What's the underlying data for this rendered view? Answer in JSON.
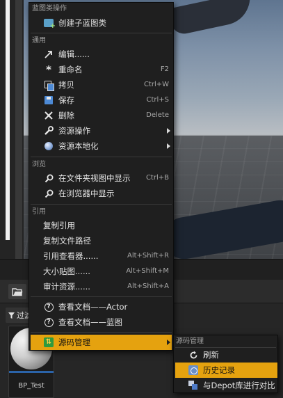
{
  "editor": {
    "toolbar_folder_icon": "folder-open-icon",
    "filter_label": "过滤",
    "asset_name": "BP_Test"
  },
  "menu": {
    "sections": {
      "blueprint": "蓝图类操作",
      "common": "通用",
      "browse": "浏览",
      "references": "引用"
    },
    "items": {
      "create_child": {
        "label": "创建子蓝图类",
        "icon": "blueprint-add-icon"
      },
      "edit": {
        "label": "编辑......",
        "icon": "edit-arrow-icon"
      },
      "rename": {
        "label": "重命名",
        "shortcut": "F2",
        "icon": "asterisk-icon"
      },
      "duplicate": {
        "label": "拷贝",
        "shortcut": "Ctrl+W",
        "icon": "copy-icon"
      },
      "save": {
        "label": "保存",
        "shortcut": "Ctrl+S",
        "icon": "save-icon"
      },
      "delete": {
        "label": "删除",
        "shortcut": "Delete",
        "icon": "delete-x-icon"
      },
      "asset_actions": {
        "label": "资源操作",
        "icon": "wrench-icon"
      },
      "localization": {
        "label": "资源本地化",
        "icon": "globe-icon"
      },
      "show_in_folder": {
        "label": "在文件夹视图中显示",
        "shortcut": "Ctrl+B",
        "icon": "search-icon"
      },
      "show_in_browser": {
        "label": "在浏览器中显示",
        "icon": "search-icon"
      },
      "copy_reference": {
        "label": "复制引用"
      },
      "copy_file_path": {
        "label": "复制文件路径"
      },
      "reference_viewer": {
        "label": "引用查看器......",
        "shortcut": "Alt+Shift+R"
      },
      "size_map": {
        "label": "大小贴图......",
        "shortcut": "Alt+Shift+M"
      },
      "audit": {
        "label": "审计资源......",
        "shortcut": "Alt+Shift+A"
      },
      "docs_actor": {
        "label": "查看文档——Actor",
        "icon": "help-icon"
      },
      "docs_blueprint": {
        "label": "查看文档——蓝图",
        "icon": "help-icon"
      },
      "source_control": {
        "label": "源码管理",
        "icon": "source-control-icon"
      }
    }
  },
  "submenu": {
    "section": "源码管理",
    "items": {
      "refresh": {
        "label": "刷新",
        "icon": "refresh-icon"
      },
      "history": {
        "label": "历史记录",
        "icon": "history-icon"
      },
      "diff_depot": {
        "label": "与Depot库进行对比",
        "icon": "diff-icon"
      }
    }
  },
  "colors": {
    "highlight": "#e5a20f",
    "menu_bg": "#1f1f1f"
  }
}
